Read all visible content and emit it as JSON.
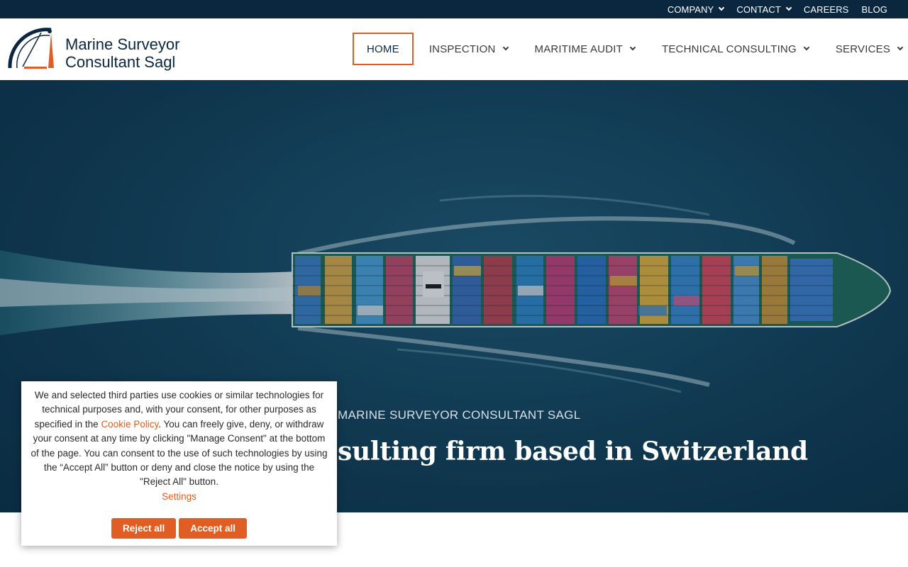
{
  "topbar": {
    "items": [
      {
        "label": "COMPANY",
        "has_dropdown": true
      },
      {
        "label": "CONTACT",
        "has_dropdown": true
      },
      {
        "label": "CAREERS",
        "has_dropdown": false
      },
      {
        "label": "BLOG",
        "has_dropdown": false
      }
    ]
  },
  "logo": {
    "line1": "Marine Surveyor",
    "line2": "Consultant Sagl"
  },
  "nav": {
    "items": [
      {
        "label": "HOME",
        "active": true,
        "has_dropdown": false
      },
      {
        "label": "INSPECTION",
        "has_dropdown": true
      },
      {
        "label": "MARITIME AUDIT",
        "has_dropdown": true
      },
      {
        "label": "TECHNICAL CONSULTING",
        "has_dropdown": true
      },
      {
        "label": "SERVICES",
        "has_dropdown": true
      }
    ]
  },
  "hero": {
    "kicker": "MARINE SURVEYOR CONSULTANT SAGL",
    "title_visible": "sulting firm based in Switzerland"
  },
  "cookie": {
    "text_before_link": "We and selected third parties use cookies or similar technologies for technical purposes and, with your consent, for other purposes as specified in the ",
    "link": "Cookie Policy",
    "text_after_link": ". You can freely give, deny, or withdraw your consent at any time by clicking \"Manage Consent\" at the bottom of the page. You can consent to the use of such technologies by using the “Accept All” button or deny and close the notice by using the \"Reject All\" button.",
    "settings": "Settings",
    "reject": "Reject all",
    "accept": "Accept all"
  },
  "colors": {
    "accent": "#e05d24",
    "navy": "#0b2740"
  }
}
